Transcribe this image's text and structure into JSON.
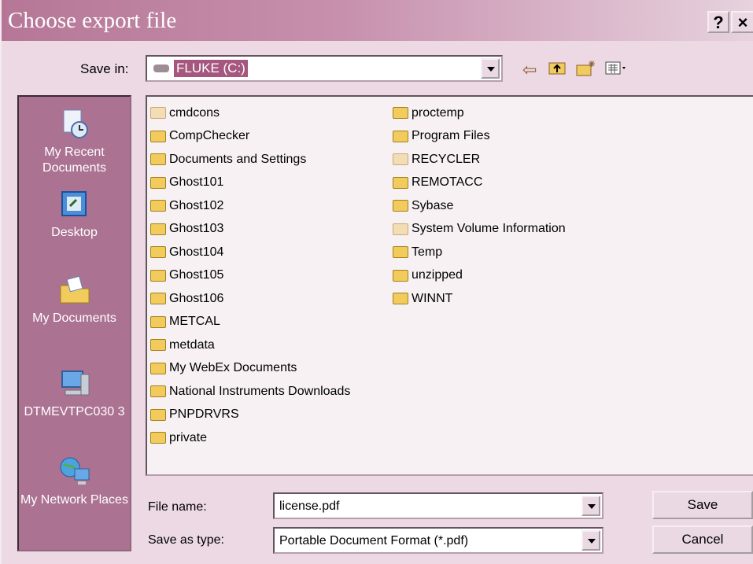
{
  "window": {
    "title": "Choose export file",
    "help_label": "?",
    "close_label": "×"
  },
  "save_in": {
    "label": "Save in:",
    "value": "FLUKE (C:)"
  },
  "toolbar": {
    "back_icon": "back-arrow-icon",
    "up_icon": "up-folder-icon",
    "new_folder_icon": "new-folder-icon",
    "view_icon": "view-menu-icon"
  },
  "places": [
    {
      "label": "My Recent Documents",
      "icon": "recent-documents-icon"
    },
    {
      "label": "Desktop",
      "icon": "desktop-icon"
    },
    {
      "label": "My Documents",
      "icon": "my-documents-icon"
    },
    {
      "label": "DTMEVTPC030 3",
      "icon": "computer-icon"
    },
    {
      "label": "My Network Places",
      "icon": "network-icon"
    }
  ],
  "folders_col1": [
    "cmdcons",
    "CompChecker",
    "Documents and Settings",
    "Ghost101",
    "Ghost102",
    "Ghost103",
    "Ghost104",
    "Ghost105",
    "Ghost106",
    "METCAL",
    "metdata",
    "My WebEx Documents",
    "National Instruments Downloads",
    "PNPDRVRS",
    "private"
  ],
  "folders_col2": [
    "proctemp",
    "Program Files",
    "RECYCLER",
    "REMOTACC",
    "Sybase",
    "System Volume Information",
    "Temp",
    "unzipped",
    "WINNT"
  ],
  "file_name": {
    "label": "File name:",
    "value": "license.pdf"
  },
  "save_as_type": {
    "label": "Save as type:",
    "value": "Portable Document Format (*.pdf)"
  },
  "buttons": {
    "save": "Save",
    "cancel": "Cancel"
  }
}
